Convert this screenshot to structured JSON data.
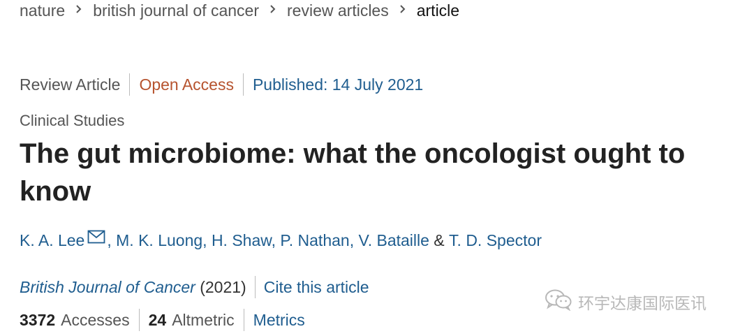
{
  "breadcrumb": {
    "items": [
      "nature",
      "british journal of cancer",
      "review articles",
      "article"
    ]
  },
  "meta": {
    "article_type": "Review Article",
    "access": "Open Access",
    "published": "Published: 14 July 2021"
  },
  "subject": "Clinical Studies",
  "title": "The gut microbiome: what the oncologist ought to know",
  "authors": {
    "first": "K. A. Lee",
    "middle": ", M. K. Luong, H. Shaw, P. Nathan, V. Bataille",
    "conjunction": " & ",
    "last": "T. D. Spector",
    "email_icon": "envelope-icon"
  },
  "citation": {
    "journal": "British Journal of Cancer",
    "year": "(2021)",
    "cite_label": "Cite this article"
  },
  "metrics": {
    "accesses_value": "3372",
    "accesses_label": "Accesses",
    "altmetric_value": "24",
    "altmetric_label": "Altmetric",
    "metrics_link": "Metrics"
  },
  "watermark": {
    "text": "环宇达康国际医讯",
    "icon": "wechat-icon"
  },
  "colors": {
    "link": "#1f5d8f",
    "open_access": "#b6532e",
    "muted": "#555555",
    "title": "#222222",
    "watermark": "#b8b8b8"
  }
}
